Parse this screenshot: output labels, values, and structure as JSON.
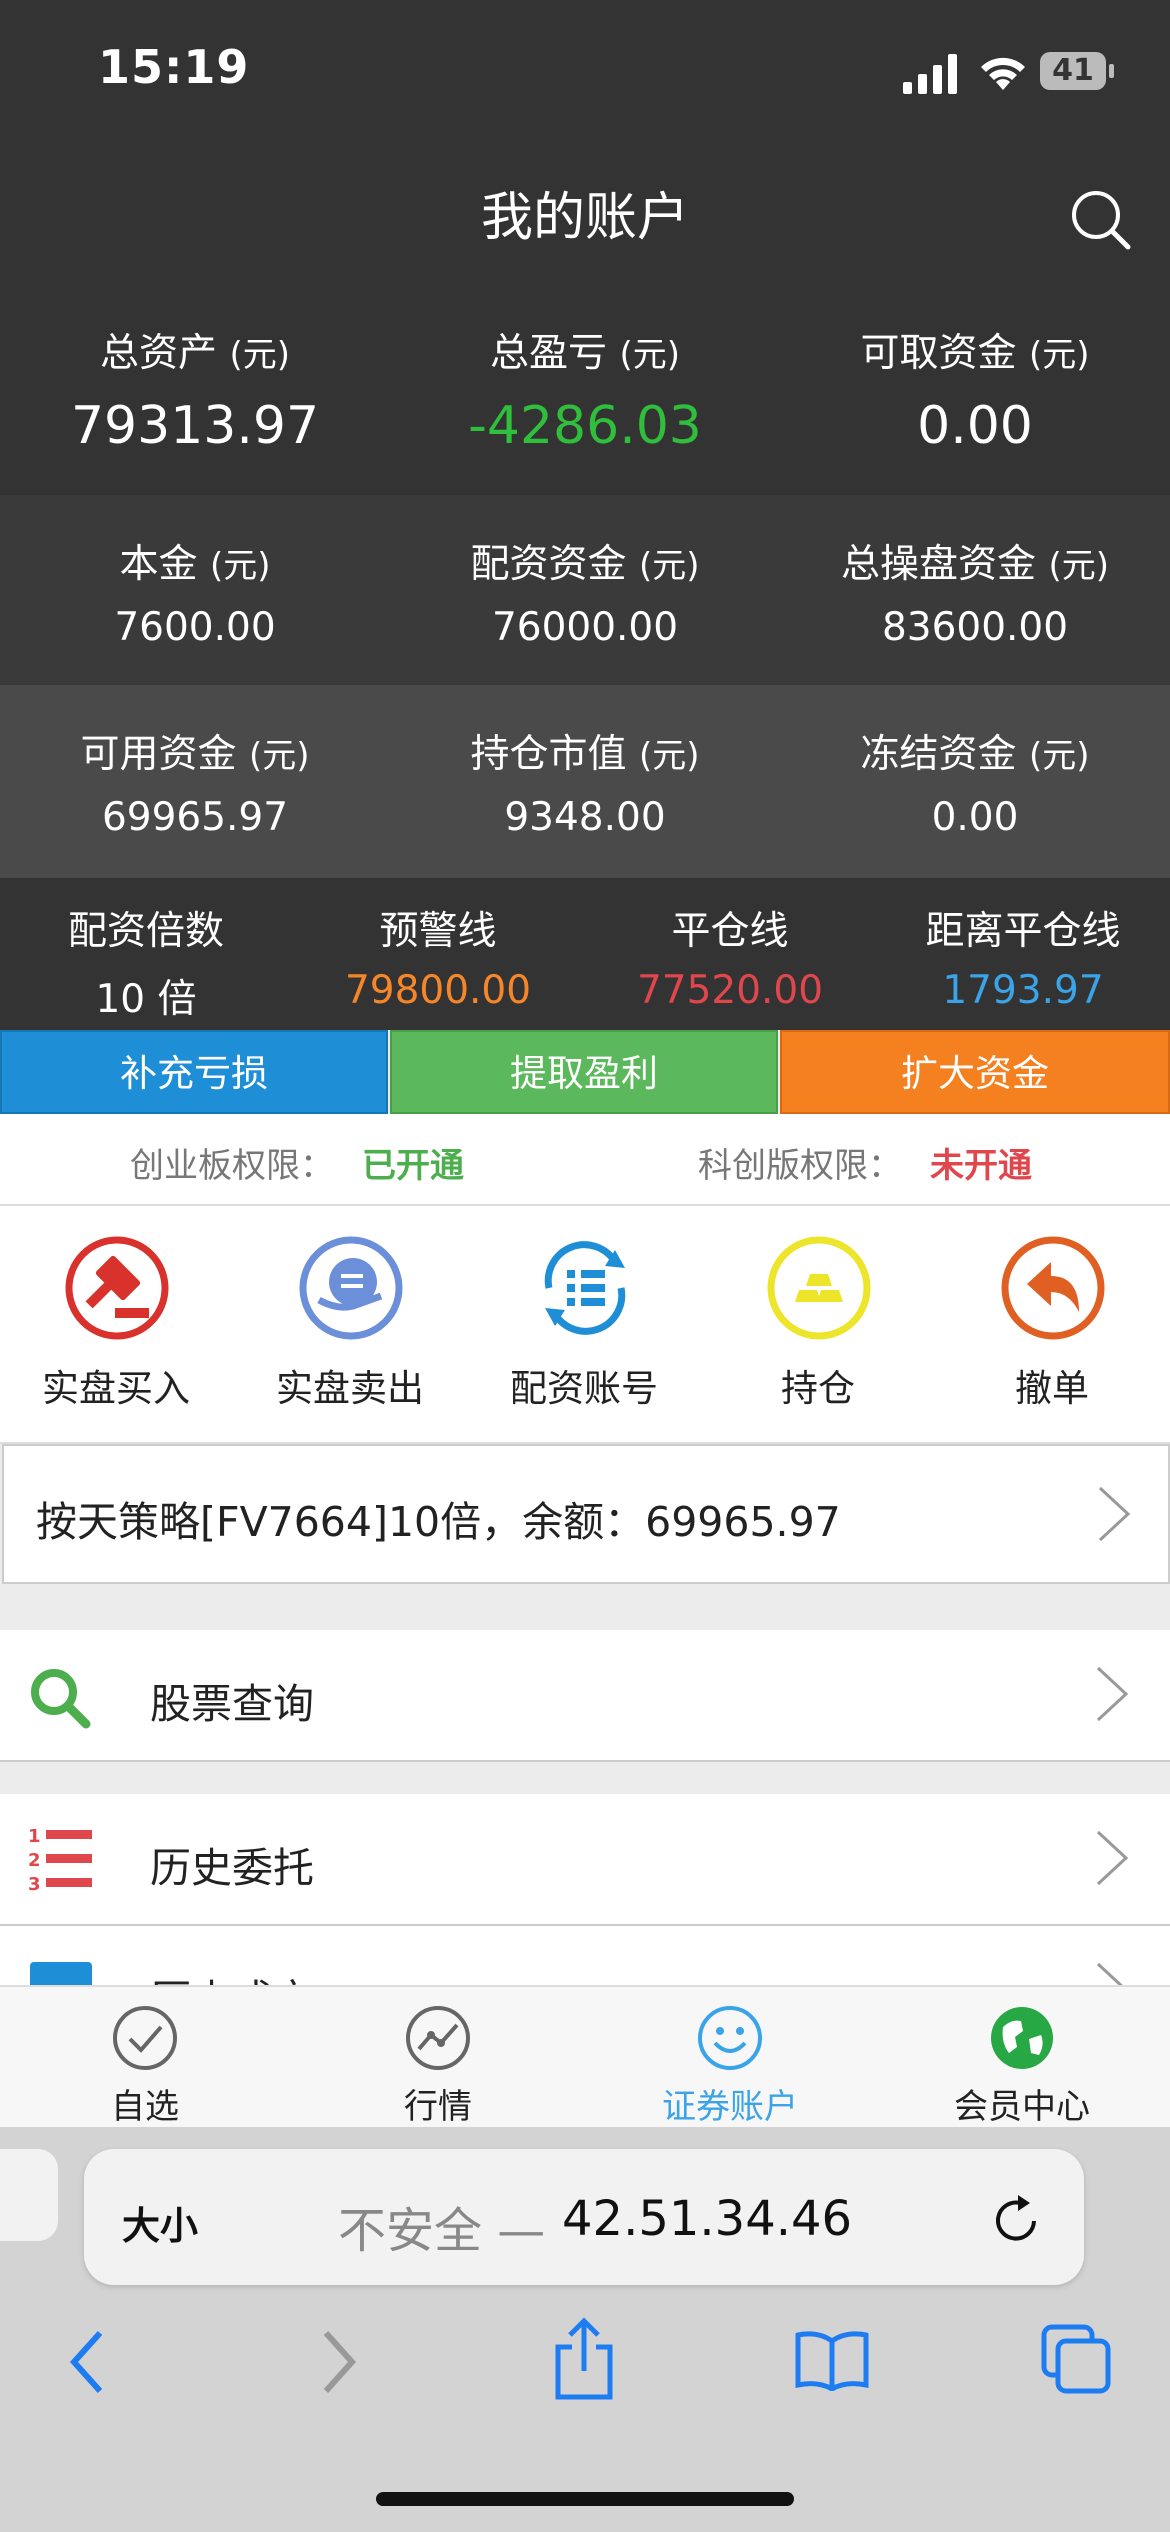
{
  "status": {
    "time": "15:19",
    "battery": "41"
  },
  "header": {
    "title": "我的账户"
  },
  "summary": {
    "total_assets": {
      "label": "总资产",
      "unit": "(元)",
      "value": "79313.97"
    },
    "total_pl": {
      "label": "总盈亏",
      "unit": "(元)",
      "value": "-4286.03"
    },
    "withdrawable": {
      "label": "可取资金",
      "unit": "(元)",
      "value": "0.00"
    }
  },
  "row2": {
    "principal": {
      "label": "本金",
      "unit": "(元)",
      "value": "7600.00"
    },
    "allocated": {
      "label": "配资资金",
      "unit": "(元)",
      "value": "76000.00"
    },
    "total_trading": {
      "label": "总操盘资金",
      "unit": "(元)",
      "value": "83600.00"
    }
  },
  "row3": {
    "available": {
      "label": "可用资金",
      "unit": "(元)",
      "value": "69965.97"
    },
    "position_value": {
      "label": "持仓市值",
      "unit": "(元)",
      "value": "9348.00"
    },
    "frozen": {
      "label": "冻结资金",
      "unit": "(元)",
      "value": "0.00"
    }
  },
  "row4": {
    "leverage": {
      "label": "配资倍数",
      "value": "10 倍"
    },
    "warning_line": {
      "label": "预警线",
      "value": "79800.00"
    },
    "liquidation_line": {
      "label": "平仓线",
      "value": "77520.00"
    },
    "distance": {
      "label": "距离平仓线",
      "value": "1793.97"
    }
  },
  "actions": {
    "topup": "补充亏损",
    "withdraw_profit": "提取盈利",
    "expand": "扩大资金"
  },
  "permissions": {
    "chinext_label": "创业板权限：",
    "chinext_value": "已开通",
    "star_label": "科创版权限：",
    "star_value": "未开通"
  },
  "functions": [
    "实盘买入",
    "实盘卖出",
    "配资账号",
    "持仓",
    "撤单"
  ],
  "strategy": {
    "text": "按天策略[FV7664]10倍，余额：69965.97"
  },
  "list": [
    "股票查询",
    "历史委托",
    "历史成交"
  ],
  "tabs": [
    "自选",
    "行情",
    "证券账户",
    "会员中心"
  ],
  "browser": {
    "text_size": "大小",
    "insecure": "不安全 — ",
    "address": "42.51.34.46"
  },
  "colors": {
    "dark_bg": "#333333",
    "row3_bg": "#4a4a4a",
    "green": "#2fbf3c",
    "orange": "#f5872a",
    "red": "#e0474d",
    "blue": "#3ba3e8",
    "btn_blue": "#1e8fd6",
    "btn_green": "#5cb85c",
    "btn_orange": "#f58020"
  }
}
